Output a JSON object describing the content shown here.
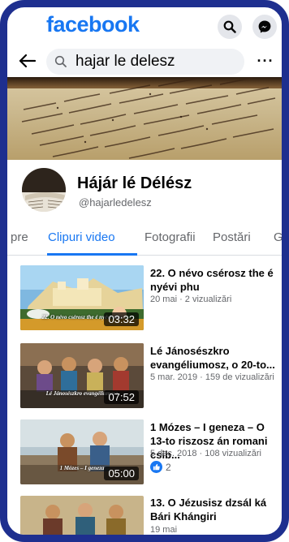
{
  "app": {
    "logo_text": "facebook",
    "brand_color": "#1877f2",
    "frame_color": "#1e2f8f",
    "search_icon": "search-icon",
    "messenger_icon": "messenger-icon"
  },
  "search": {
    "query": "hajar le delesz",
    "back_icon": "back-arrow-icon",
    "more_icon": "more-dots-icon",
    "more_label": "···"
  },
  "profile": {
    "name": "Hájár lé Délész",
    "handle": "@hajarledelesz"
  },
  "tabs": [
    {
      "label": "pre",
      "active": false
    },
    {
      "label": "Clipuri video",
      "active": true
    },
    {
      "label": "Fotografii",
      "active": false
    },
    {
      "label": "Postări",
      "active": false
    },
    {
      "label": "G",
      "active": false
    }
  ],
  "videos": [
    {
      "title": "22. O névo csérosz the é nyévi phu",
      "meta": "20 mai · 2 vizualizări",
      "duration": "03:32",
      "caption": "22. O névo csérosz\nthe é nyévi phu",
      "likes": null
    },
    {
      "title": "Lé Jánosészkro evangéliumosz, o 20-to...",
      "meta": "5 mar. 2019 · 159 de vizualizări",
      "duration": "07:52",
      "caption": "Lé Jánosészkro evangéliumosz\nO 20-to riszosz",
      "likes": null
    },
    {
      "title": "1 Mózes – I geneza – O 13-to riszosz án romani csib...",
      "meta": "5 dec. 2018 · 108 vizualizări",
      "duration": "05:00",
      "caption": "1 Mózes – I geneza\nO 13-to riszosz",
      "likes": "2"
    },
    {
      "title": "13. O Jézusisz dzsál ká Bári Khángiri",
      "meta": "19 mai",
      "duration": "",
      "caption": "",
      "likes": null
    }
  ]
}
